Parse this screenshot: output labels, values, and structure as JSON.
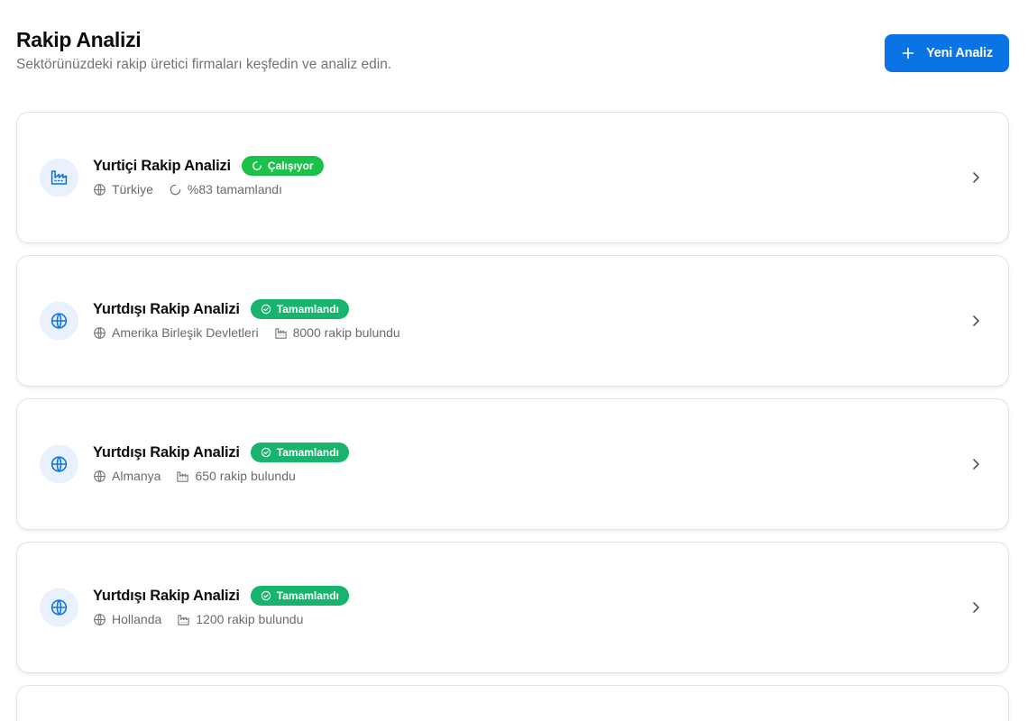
{
  "header": {
    "title": "Rakip Analizi",
    "subtitle": "Sektörünüzdeki rakip üretici firmaları keşfedin ve analiz edin.",
    "new_button_label": "Yeni Analiz"
  },
  "colors": {
    "primary": "#0a74e6",
    "badge_running": "#1bc24a",
    "badge_done": "#16b46c",
    "icon_bg": "#e8f1fd"
  },
  "analyses": [
    {
      "title": "Yurtiçi Rakip Analizi",
      "icon": "factory-icon",
      "status": "Çalışıyor",
      "status_icon": "spinner-icon",
      "country": "Türkiye",
      "detail_icon": "spinner-icon",
      "detail": "%83 tamamlandı"
    },
    {
      "title": "Yurtdışı Rakip Analizi",
      "icon": "globe-icon",
      "status": "Tamamlandı",
      "status_icon": "check-circle-icon",
      "country": "Amerika Birleşik Devletleri",
      "detail_icon": "factory-icon",
      "detail": "8000 rakip bulundu"
    },
    {
      "title": "Yurtdışı Rakip Analizi",
      "icon": "globe-icon",
      "status": "Tamamlandı",
      "status_icon": "check-circle-icon",
      "country": "Almanya",
      "detail_icon": "factory-icon",
      "detail": "650 rakip bulundu"
    },
    {
      "title": "Yurtdışı Rakip Analizi",
      "icon": "globe-icon",
      "status": "Tamamlandı",
      "status_icon": "check-circle-icon",
      "country": "Hollanda",
      "detail_icon": "factory-icon",
      "detail": "1200 rakip bulundu"
    }
  ]
}
